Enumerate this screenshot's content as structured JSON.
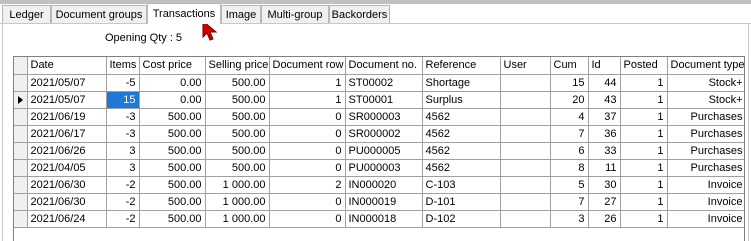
{
  "tabs": [
    {
      "label": "Ledger",
      "active": false
    },
    {
      "label": "Document groups",
      "active": false
    },
    {
      "label": "Transactions",
      "active": true
    },
    {
      "label": "Image",
      "active": false
    },
    {
      "label": "Multi-group",
      "active": false
    },
    {
      "label": "Backorders",
      "active": false
    }
  ],
  "opening_qty": "Opening Qty : 5",
  "columns": [
    "Date",
    "Items",
    "Cost price",
    "Selling price",
    "Document row",
    "Document no.",
    "Reference",
    "User",
    "Cum",
    "Id",
    "Posted",
    "Document type"
  ],
  "rows": [
    {
      "date": "2021/05/07",
      "items": "-5",
      "cost": "0.00",
      "selling": "500.00",
      "docrow": "1",
      "docno": "ST00002",
      "reference": "Shortage",
      "user": "",
      "cum": "15",
      "id": "44",
      "posted": "1",
      "doctype": "Stock+"
    },
    {
      "date": "2021/05/07",
      "items": "15",
      "cost": "0.00",
      "selling": "500.00",
      "docrow": "1",
      "docno": "ST00001",
      "reference": "Surplus",
      "user": "",
      "cum": "20",
      "id": "43",
      "posted": "1",
      "doctype": "Stock+"
    },
    {
      "date": "2021/06/19",
      "items": "-3",
      "cost": "500.00",
      "selling": "500.00",
      "docrow": "0",
      "docno": "SR000003",
      "reference": "4562",
      "user": "",
      "cum": "4",
      "id": "37",
      "posted": "1",
      "doctype": "Purchases"
    },
    {
      "date": "2021/06/17",
      "items": "-3",
      "cost": "500.00",
      "selling": "500.00",
      "docrow": "0",
      "docno": "SR000002",
      "reference": "4562",
      "user": "",
      "cum": "7",
      "id": "36",
      "posted": "1",
      "doctype": "Purchases"
    },
    {
      "date": "2021/06/26",
      "items": "3",
      "cost": "500.00",
      "selling": "500.00",
      "docrow": "0",
      "docno": "PU000005",
      "reference": "4562",
      "user": "",
      "cum": "6",
      "id": "33",
      "posted": "1",
      "doctype": "Purchases"
    },
    {
      "date": "2021/04/05",
      "items": "3",
      "cost": "500.00",
      "selling": "500.00",
      "docrow": "0",
      "docno": "PU000003",
      "reference": "4562",
      "user": "",
      "cum": "8",
      "id": "11",
      "posted": "1",
      "doctype": "Purchases"
    },
    {
      "date": "2021/06/30",
      "items": "-2",
      "cost": "500.00",
      "selling": "1 000.00",
      "docrow": "2",
      "docno": "IN000020",
      "reference": "C-103",
      "user": "",
      "cum": "5",
      "id": "30",
      "posted": "1",
      "doctype": "Invoice"
    },
    {
      "date": "2021/06/30",
      "items": "-2",
      "cost": "500.00",
      "selling": "1 000.00",
      "docrow": "0",
      "docno": "IN000019",
      "reference": "D-101",
      "user": "",
      "cum": "7",
      "id": "27",
      "posted": "1",
      "doctype": "Invoice"
    },
    {
      "date": "2021/06/24",
      "items": "-2",
      "cost": "500.00",
      "selling": "1 000.00",
      "docrow": "0",
      "docno": "IN000018",
      "reference": "D-102",
      "user": "",
      "cum": "3",
      "id": "26",
      "posted": "1",
      "doctype": "Invoice"
    }
  ],
  "current_row": 1,
  "selected_cell": "items",
  "colors": {
    "selection": "#1e78d7",
    "cursor": "#d40000"
  }
}
